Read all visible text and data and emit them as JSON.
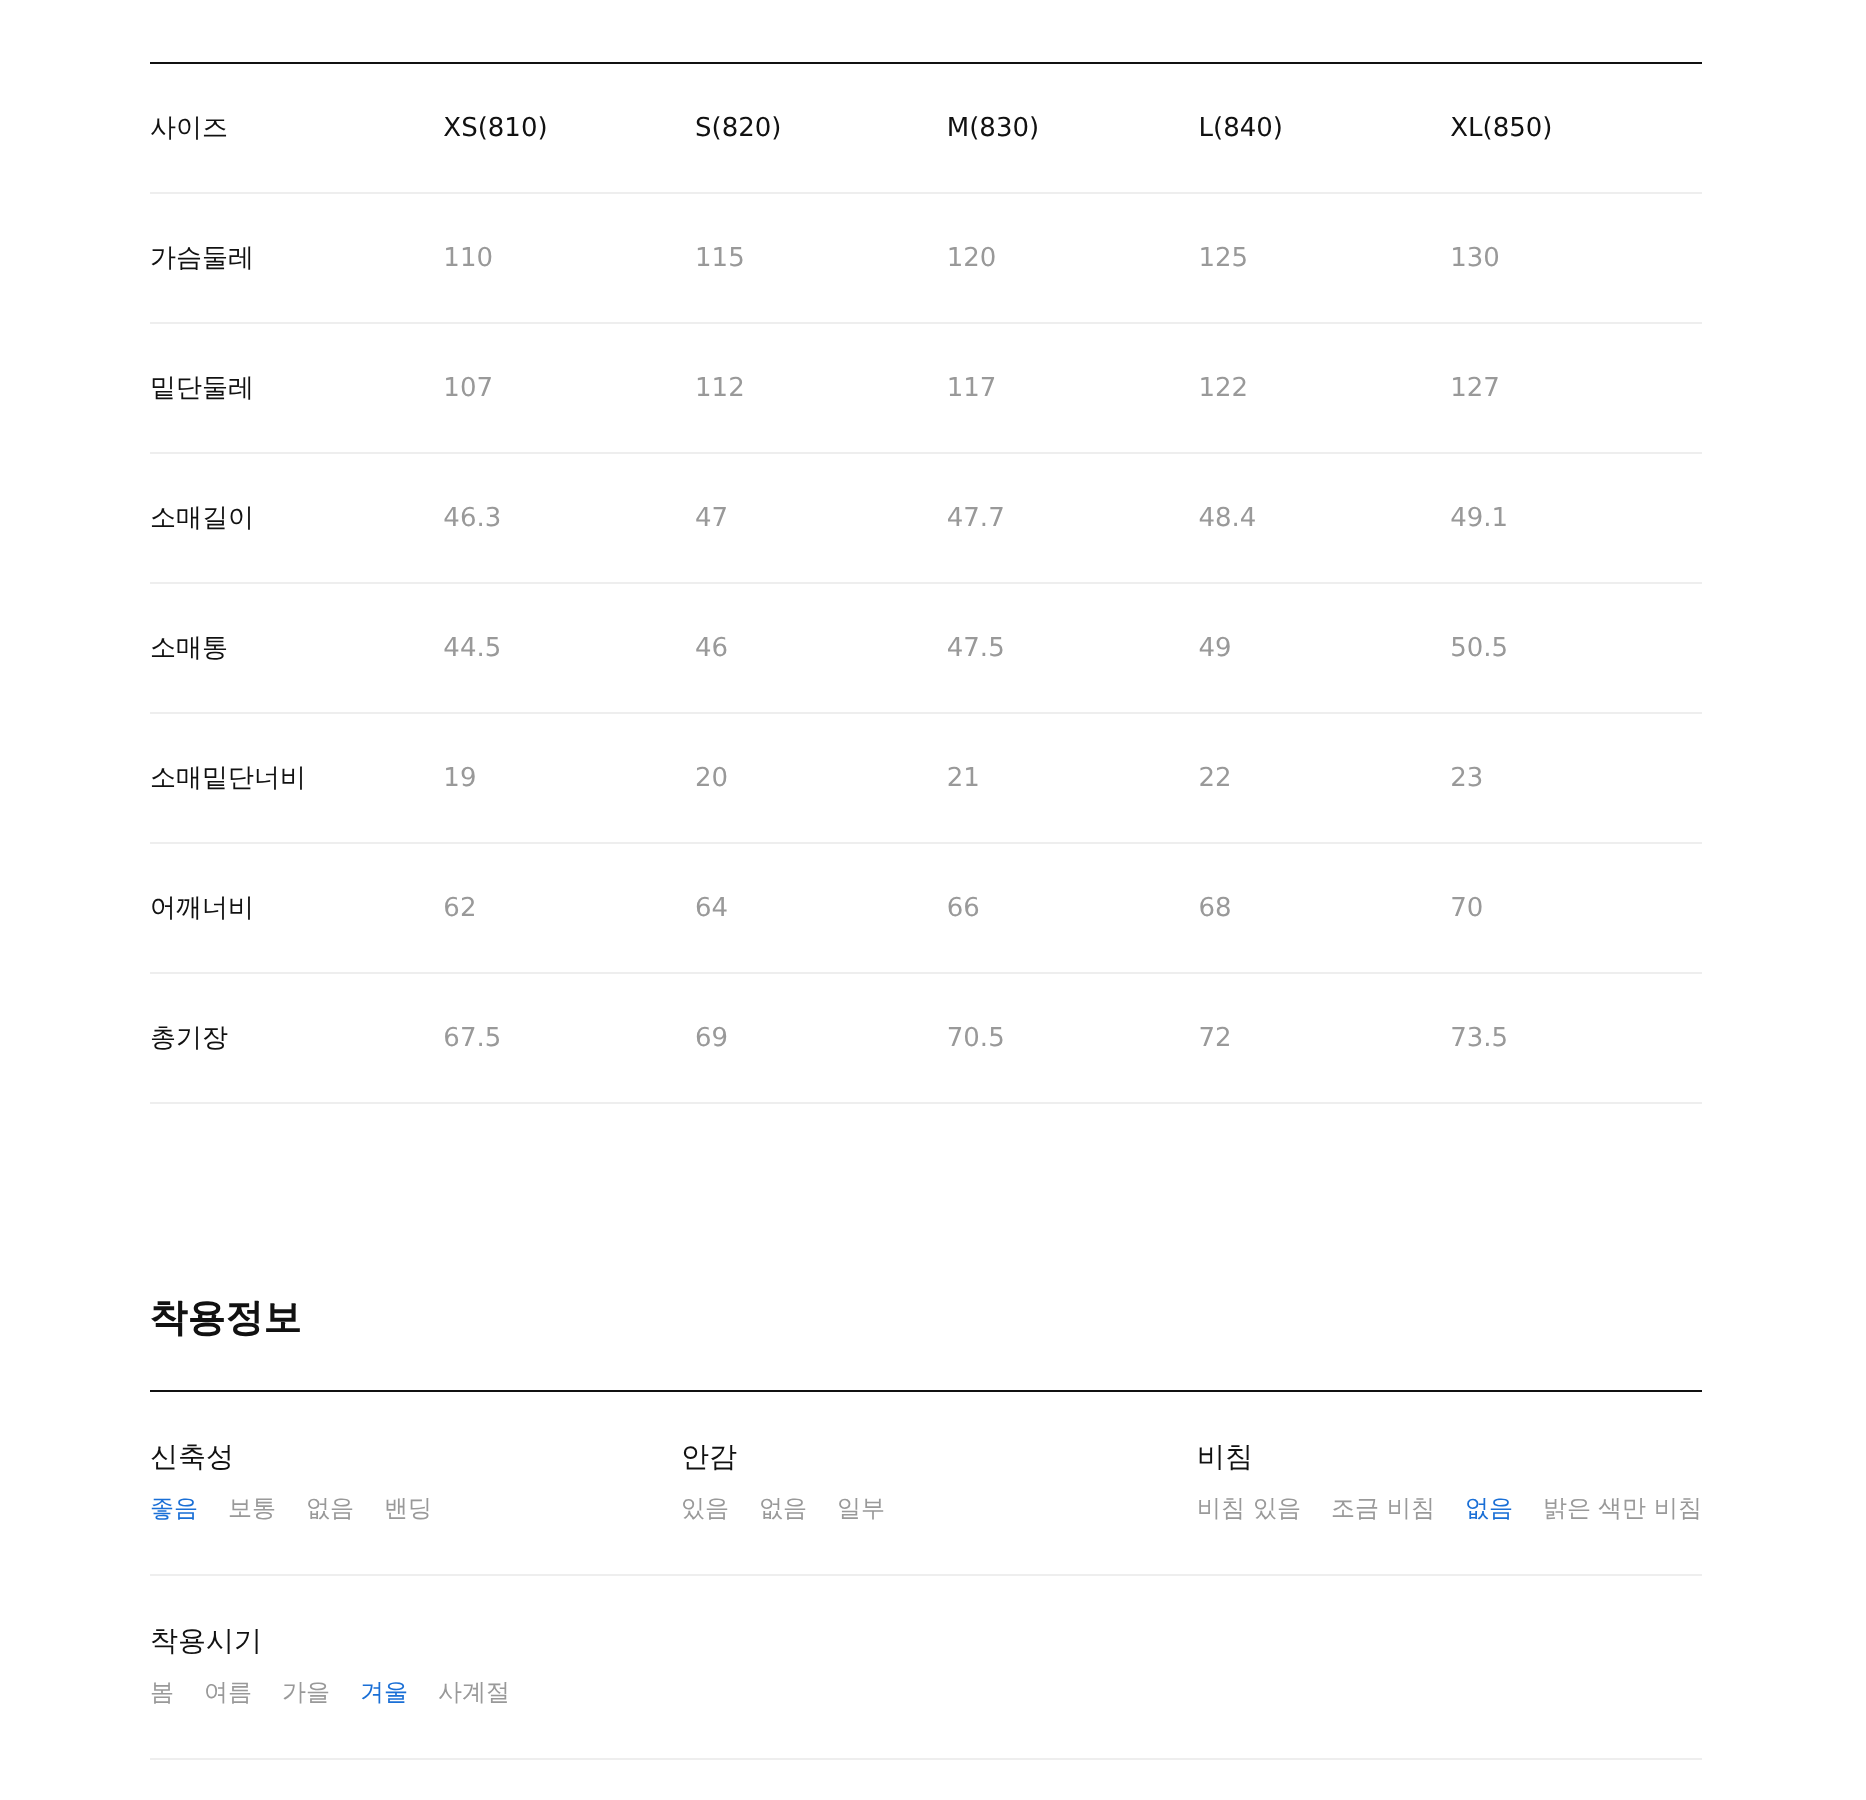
{
  "size_table": {
    "columns": [
      "사이즈",
      "XS(810)",
      "S(820)",
      "M(830)",
      "L(840)",
      "XL(850)"
    ],
    "rows": [
      {
        "label": "가슴둘레",
        "values": [
          "110",
          "115",
          "120",
          "125",
          "130"
        ]
      },
      {
        "label": "밑단둘레",
        "values": [
          "107",
          "112",
          "117",
          "122",
          "127"
        ]
      },
      {
        "label": "소매길이",
        "values": [
          "46.3",
          "47",
          "47.7",
          "48.4",
          "49.1"
        ]
      },
      {
        "label": "소매통",
        "values": [
          "44.5",
          "46",
          "47.5",
          "49",
          "50.5"
        ]
      },
      {
        "label": "소매밑단너비",
        "values": [
          "19",
          "20",
          "21",
          "22",
          "23"
        ]
      },
      {
        "label": "어깨너비",
        "values": [
          "62",
          "64",
          "66",
          "68",
          "70"
        ]
      },
      {
        "label": "총기장",
        "values": [
          "67.5",
          "69",
          "70.5",
          "72",
          "73.5"
        ]
      }
    ]
  },
  "fit_info": {
    "title": "착용정보",
    "rows": [
      [
        {
          "label": "신축성",
          "options": [
            {
              "text": "좋음",
              "selected": true
            },
            {
              "text": "보통",
              "selected": false
            },
            {
              "text": "없음",
              "selected": false
            },
            {
              "text": "밴딩",
              "selected": false
            }
          ]
        },
        {
          "label": "안감",
          "options": [
            {
              "text": "있음",
              "selected": false
            },
            {
              "text": "없음",
              "selected": false
            },
            {
              "text": "일부",
              "selected": false
            }
          ]
        },
        {
          "label": "비침",
          "options": [
            {
              "text": "비침 있음",
              "selected": false
            },
            {
              "text": "조금 비침",
              "selected": false
            },
            {
              "text": "없음",
              "selected": true
            },
            {
              "text": "밝은 색만 비침",
              "selected": false
            }
          ]
        }
      ],
      [
        {
          "label": "착용시기",
          "options": [
            {
              "text": "봄",
              "selected": false
            },
            {
              "text": "여름",
              "selected": false
            },
            {
              "text": "가을",
              "selected": false
            },
            {
              "text": "겨울",
              "selected": true
            },
            {
              "text": "사계절",
              "selected": false
            }
          ]
        }
      ]
    ]
  }
}
